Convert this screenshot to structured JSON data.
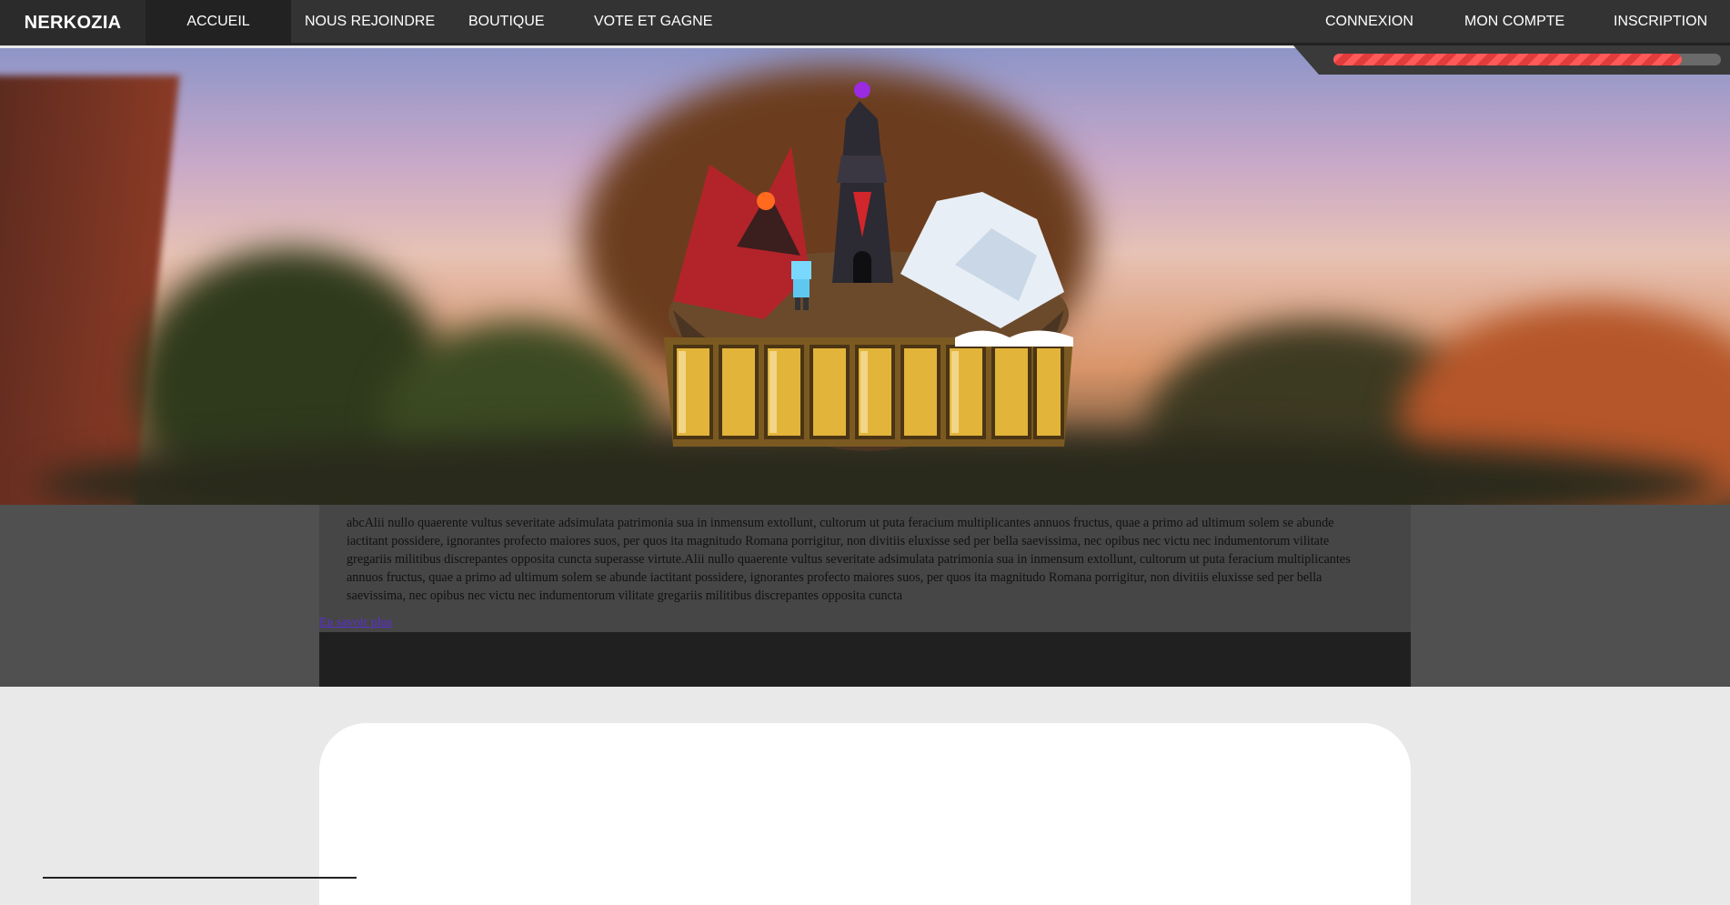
{
  "brand": {
    "name": "NERKOZIA"
  },
  "nav": {
    "left": [
      "ACCUEIL",
      "NOUS REJOINDRE",
      "BOUTIQUE",
      "VOTE ET GAGNE"
    ],
    "right": [
      "CONNEXION",
      "MON COMPTE",
      "INSCRIPTION"
    ],
    "active": "ACCUEIL"
  },
  "server_bar": {
    "fill_fraction": 0.9,
    "color": "#ff5a5a"
  },
  "hero": {
    "logo_alt": "NERKOZIA"
  },
  "article": {
    "text": "abcAlii nullo quaerente vultus severitate adsimulata patrimonia sua in inmensum extollunt, cultorum ut puta feracium multiplicantes annuos fructus, quae a primo ad ultimum solem se abunde iactitant possidere, ignorantes profecto maiores suos, per quos ita magnitudo Romana porrigitur, non divitiis eluxisse sed per bella saevissima, nec opibus nec victu nec indumentorum vilitate gregariis militibus discrepantes opposita cuncta superasse virtute.Alii nullo quaerente vultus severitate adsimulata patrimonia sua in inmensum extollunt, cultorum ut puta feracium multiplicantes annuos fructus, quae a primo ad ultimum solem se abunde iactitant possidere, ignorantes profecto maiores suos, per quos ita magnitudo Romana porrigitur, non divitiis eluxisse sed per bella saevissima, nec opibus nec victu nec indumentorum vilitate gregariis militibus discrepantes opposita cuncta",
    "read_more": "En savoir plus"
  },
  "colors": {
    "navbar": "#333333",
    "accent": "#ff5a5a",
    "link": "#5b2fd6"
  }
}
